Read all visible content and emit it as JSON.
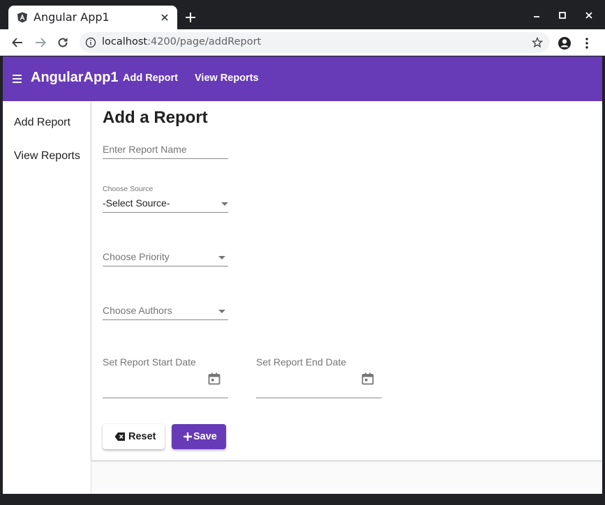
{
  "browser": {
    "tab_title": "Angular App1",
    "url_host": "localhost",
    "url_path": ":4200/page/addReport"
  },
  "app": {
    "brand": "AngularApp1",
    "nav_links": [
      "Add Report",
      "View Reports"
    ],
    "sidenav_items": [
      "Add Report",
      "View Reports"
    ],
    "accent_color": "#673ab7"
  },
  "form": {
    "title": "Add a Report",
    "report_name_placeholder": "Enter Report Name",
    "source_label": "Choose Source",
    "source_value": "-Select Source-",
    "priority_placeholder": "Choose Priority",
    "authors_placeholder": "Choose Authors",
    "start_date_placeholder": "Set Report Start Date",
    "end_date_placeholder": "Set Report End Date",
    "reset_label": "Reset",
    "save_label": "Save"
  }
}
